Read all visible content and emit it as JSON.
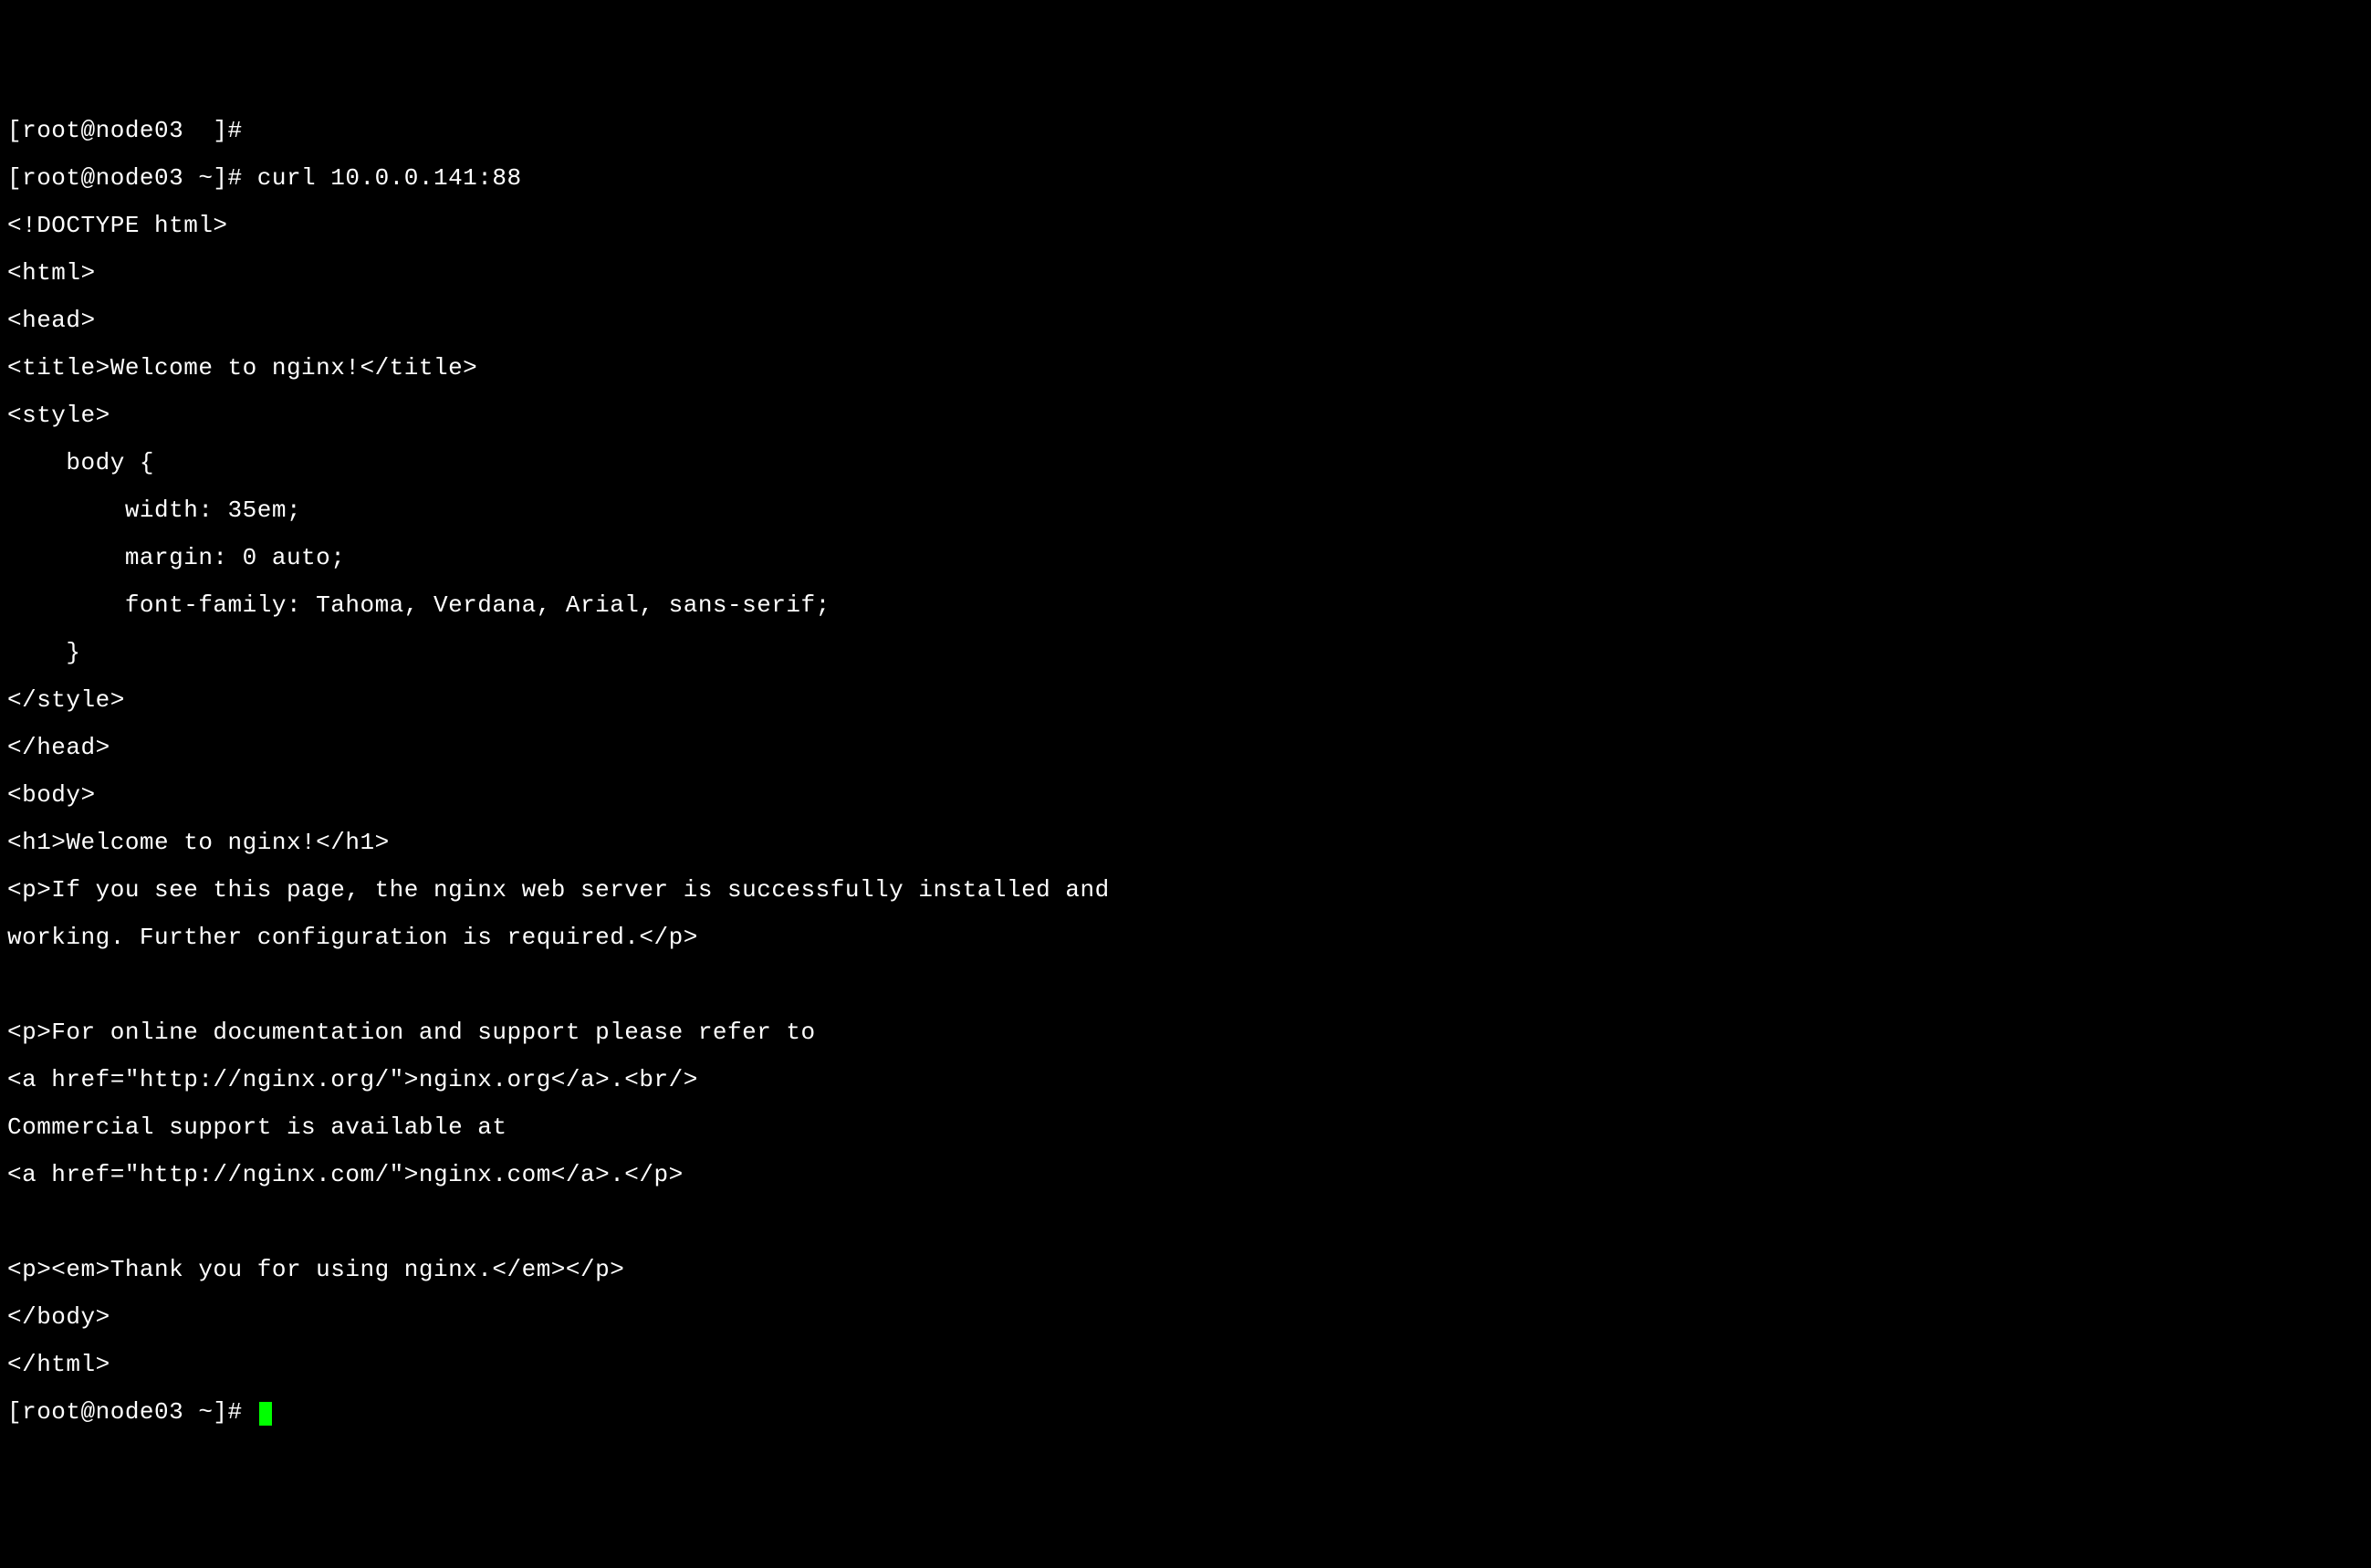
{
  "lines": [
    "[root@node03  ]# ",
    "[root@node03 ~]# curl 10.0.0.141:88",
    "<!DOCTYPE html>",
    "<html>",
    "<head>",
    "<title>Welcome to nginx!</title>",
    "<style>",
    "    body {",
    "        width: 35em;",
    "        margin: 0 auto;",
    "        font-family: Tahoma, Verdana, Arial, sans-serif;",
    "    }",
    "</style>",
    "</head>",
    "<body>",
    "<h1>Welcome to nginx!</h1>",
    "<p>If you see this page, the nginx web server is successfully installed and",
    "working. Further configuration is required.</p>",
    "",
    "<p>For online documentation and support please refer to",
    "<a href=\"http://nginx.org/\">nginx.org</a>.<br/>",
    "Commercial support is available at",
    "<a href=\"http://nginx.com/\">nginx.com</a>.</p>",
    "",
    "<p><em>Thank you for using nginx.</em></p>",
    "</body>",
    "</html>"
  ],
  "prompt_final": "[root@node03 ~]# "
}
